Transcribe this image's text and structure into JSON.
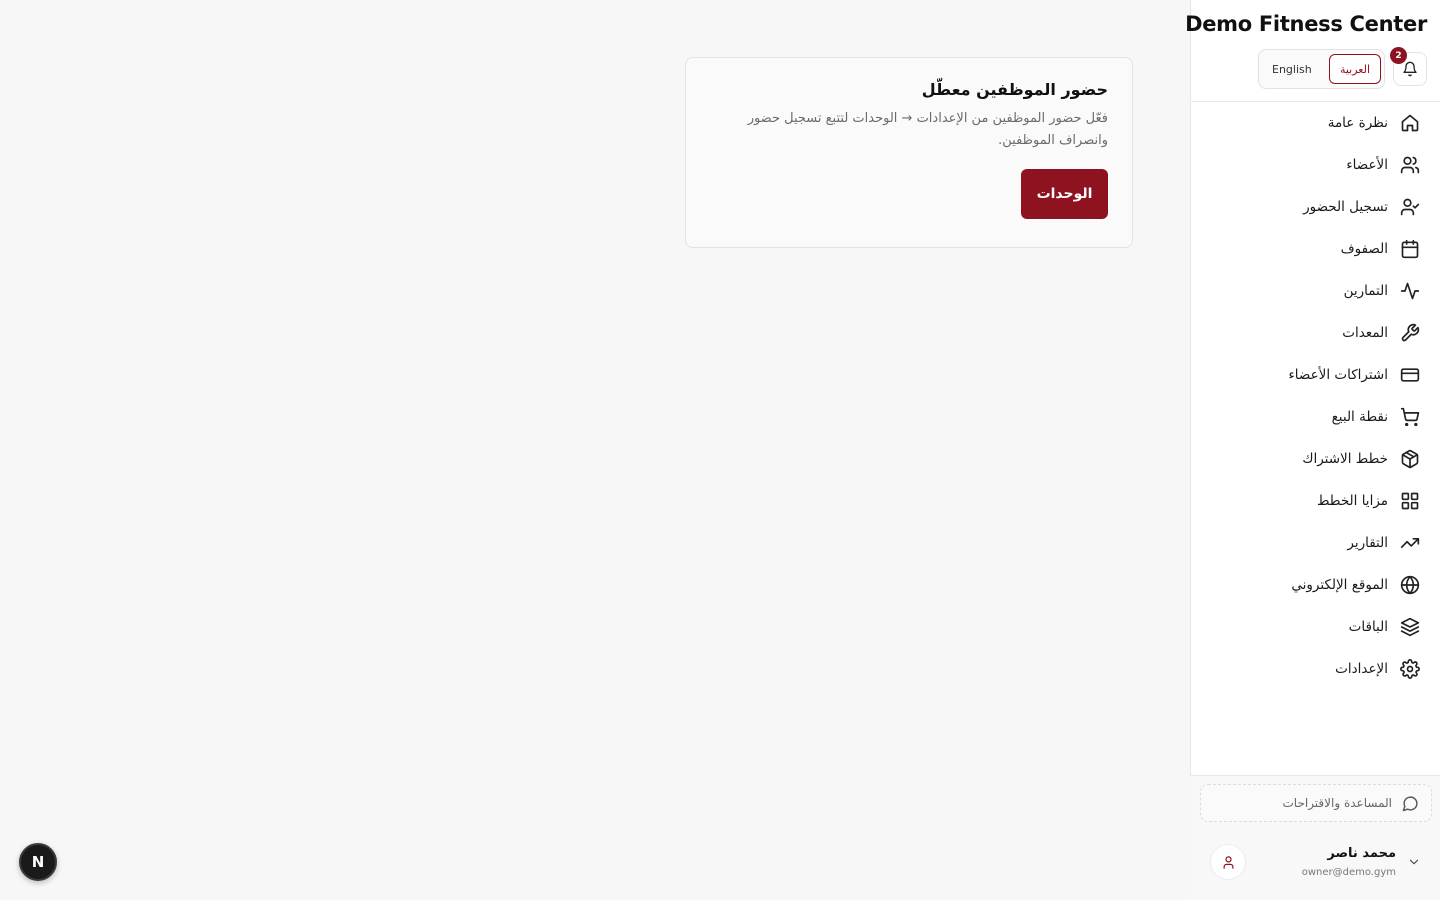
{
  "brand": {
    "name": "Demo Fitness Center"
  },
  "notifications": {
    "count": "2"
  },
  "language": {
    "options": [
      "العربية",
      "English"
    ],
    "active": "العربية"
  },
  "nav": {
    "items": [
      {
        "label": "نظرة عامة",
        "icon": "home-icon"
      },
      {
        "label": "الأعضاء",
        "icon": "users-icon"
      },
      {
        "label": "تسجيل الحضور",
        "icon": "user-check-icon"
      },
      {
        "label": "الصفوف",
        "icon": "calendar-icon"
      },
      {
        "label": "التمارين",
        "icon": "activity-icon"
      },
      {
        "label": "المعدات",
        "icon": "wrench-icon"
      },
      {
        "label": "اشتراكات الأعضاء",
        "icon": "credit-card-icon"
      },
      {
        "label": "نقطة البيع",
        "icon": "cart-icon"
      },
      {
        "label": "خطط الاشتراك",
        "icon": "package-icon"
      },
      {
        "label": "مزايا الخطط",
        "icon": "grid-icon"
      },
      {
        "label": "التقارير",
        "icon": "trending-up-icon"
      },
      {
        "label": "الموقع الإلكتروني",
        "icon": "globe-icon"
      },
      {
        "label": "الباقات",
        "icon": "layers-icon"
      },
      {
        "label": "الإعدادات",
        "icon": "gear-icon"
      }
    ]
  },
  "help": {
    "label": "المساعدة والاقتراحات"
  },
  "user": {
    "name": "محمد ناصر",
    "email": "owner@demo.gym"
  },
  "card": {
    "title": "حضور الموظفين معطّل",
    "description": "فعّل حضور الموظفين من الإعدادات → الوحدات لتتبع تسجيل حضور وانصراف الموظفين.",
    "button_label": "الوحدات"
  },
  "dev_indicator": {
    "label": "N"
  },
  "colors": {
    "accent": "#8f1220",
    "background": "#f7f7f7"
  }
}
